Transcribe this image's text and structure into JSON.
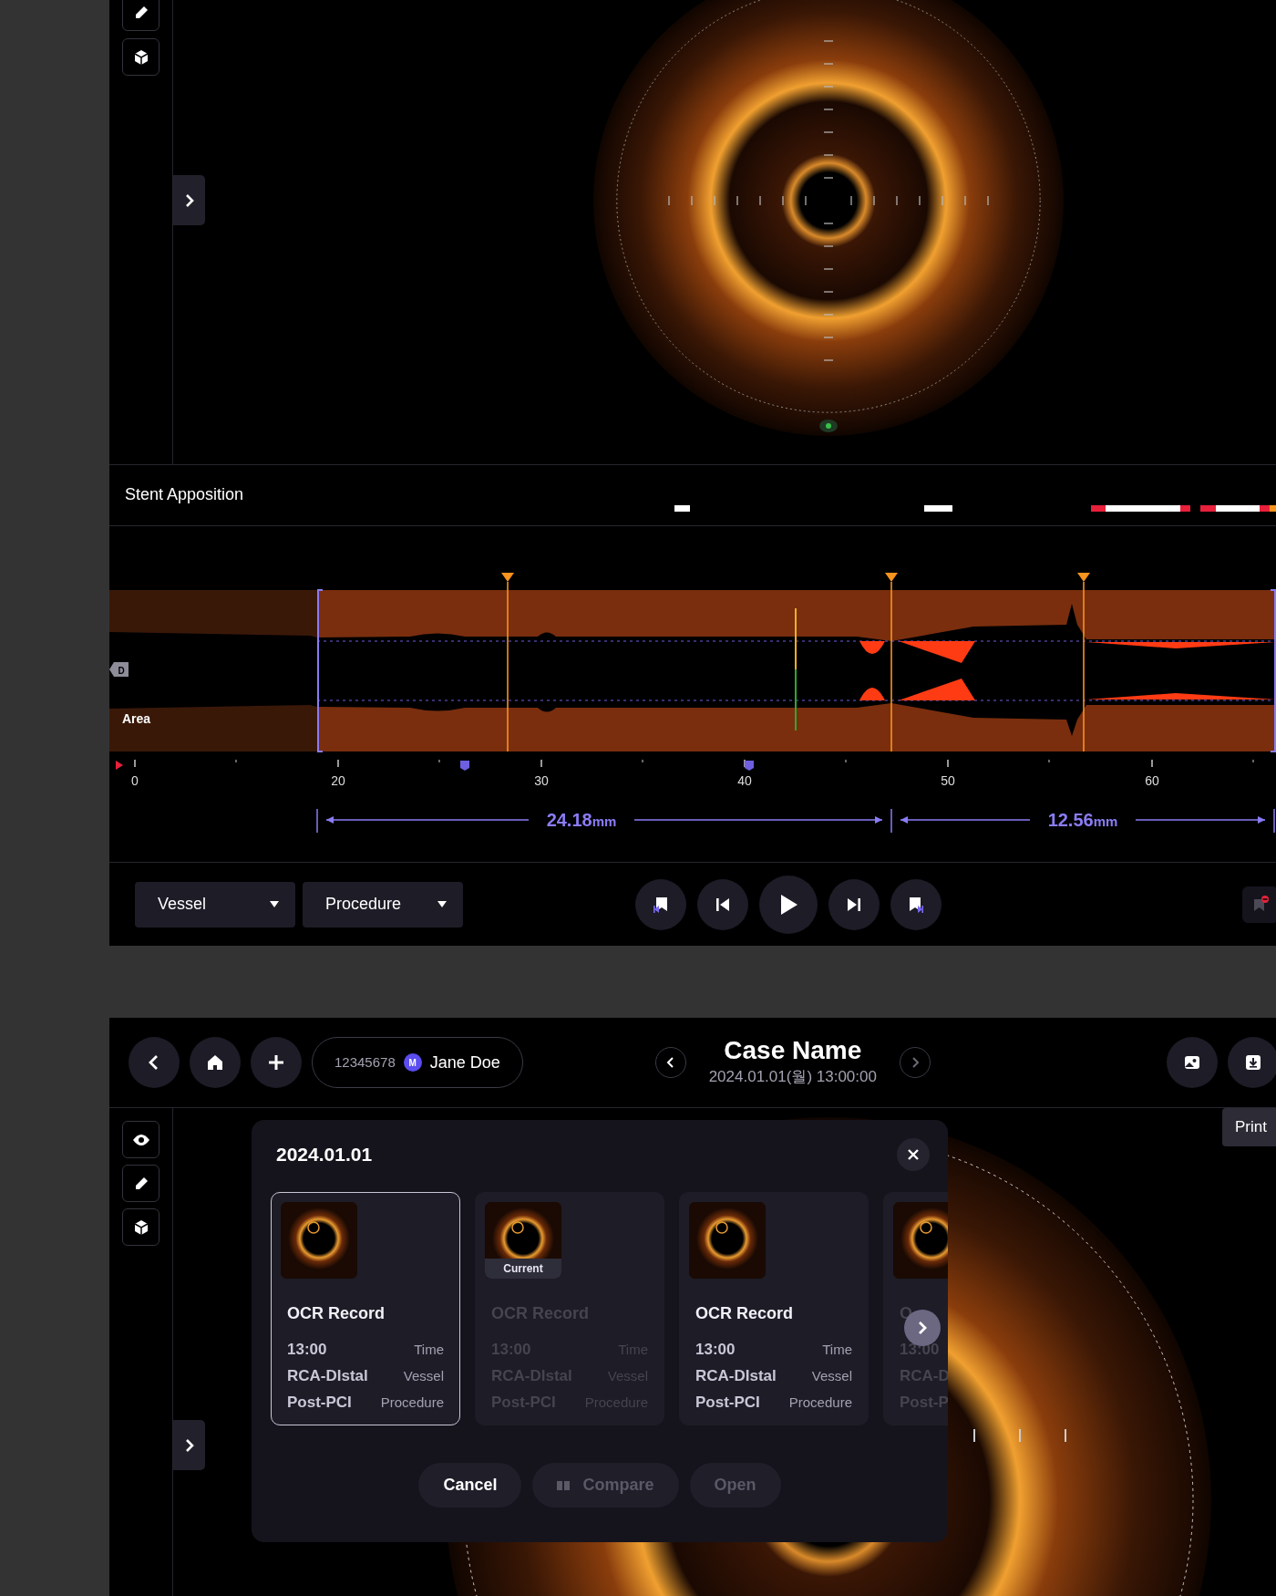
{
  "top_panel": {
    "stent_apposition": {
      "label": "Stent Apposition"
    },
    "profile": {
      "distal_tag": "D",
      "area_label": "Area",
      "axis_labels": [
        "0",
        "20",
        "30",
        "40",
        "50",
        "60"
      ]
    },
    "measurements": [
      {
        "value": "24.18",
        "unit": "mm"
      },
      {
        "value": "12.56",
        "unit": "mm"
      }
    ],
    "dropdowns": [
      {
        "label": "Vessel"
      },
      {
        "label": "Procedure"
      }
    ]
  },
  "header": {
    "patient_id": "12345678",
    "sex": "M",
    "patient_name": "Jane Doe",
    "case_name": "Case Name",
    "datetime": "2024.01.01(월) 13:00:00",
    "tooltip": "Print"
  },
  "dialog": {
    "title": "2024.01.01",
    "records": [
      {
        "kind": "full",
        "title": "OCR Record",
        "time": "13:00",
        "time_label": "Time",
        "vessel": "RCA-DIstal",
        "vessel_label": "Vessel",
        "procedure": "Post-PCI",
        "procedure_label": "Procedure",
        "selected": true,
        "disabled": false
      },
      {
        "kind": "full",
        "title": "OCR Record",
        "time": "13:00",
        "time_label": "Time",
        "vessel": "RCA-DIstal",
        "vessel_label": "Vessel",
        "procedure": "Post-PCI",
        "procedure_label": "Procedure",
        "selected": false,
        "disabled": true,
        "badge": "Current"
      },
      {
        "kind": "full",
        "title": "OCR Record",
        "time": "13:00",
        "time_label": "Time",
        "vessel": "RCA-DIstal",
        "vessel_label": "Vessel",
        "procedure": "Post-PCI",
        "procedure_label": "Procedure",
        "selected": false,
        "disabled": false
      },
      {
        "kind": "clipped",
        "title": "O",
        "time": "13:00",
        "vessel": "RCA-D",
        "procedure": "Post-P",
        "selected": false,
        "disabled": true
      }
    ],
    "buttons": [
      {
        "label": "Cancel",
        "disabled": false
      },
      {
        "label": "Compare",
        "disabled": true
      },
      {
        "label": "Open",
        "disabled": true
      }
    ]
  }
}
